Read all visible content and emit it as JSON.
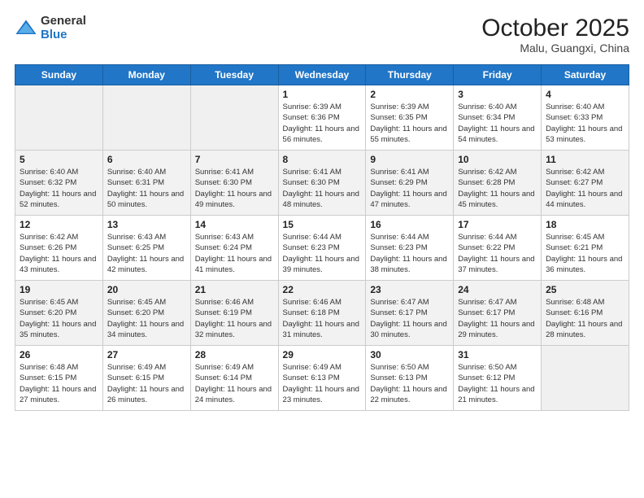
{
  "logo": {
    "line1": "General",
    "line2": "Blue"
  },
  "title": "October 2025",
  "subtitle": "Malu, Guangxi, China",
  "days_of_week": [
    "Sunday",
    "Monday",
    "Tuesday",
    "Wednesday",
    "Thursday",
    "Friday",
    "Saturday"
  ],
  "weeks": [
    [
      {
        "day": "",
        "info": ""
      },
      {
        "day": "",
        "info": ""
      },
      {
        "day": "",
        "info": ""
      },
      {
        "day": "1",
        "info": "Sunrise: 6:39 AM\nSunset: 6:36 PM\nDaylight: 11 hours and 56 minutes."
      },
      {
        "day": "2",
        "info": "Sunrise: 6:39 AM\nSunset: 6:35 PM\nDaylight: 11 hours and 55 minutes."
      },
      {
        "day": "3",
        "info": "Sunrise: 6:40 AM\nSunset: 6:34 PM\nDaylight: 11 hours and 54 minutes."
      },
      {
        "day": "4",
        "info": "Sunrise: 6:40 AM\nSunset: 6:33 PM\nDaylight: 11 hours and 53 minutes."
      }
    ],
    [
      {
        "day": "5",
        "info": "Sunrise: 6:40 AM\nSunset: 6:32 PM\nDaylight: 11 hours and 52 minutes."
      },
      {
        "day": "6",
        "info": "Sunrise: 6:40 AM\nSunset: 6:31 PM\nDaylight: 11 hours and 50 minutes."
      },
      {
        "day": "7",
        "info": "Sunrise: 6:41 AM\nSunset: 6:30 PM\nDaylight: 11 hours and 49 minutes."
      },
      {
        "day": "8",
        "info": "Sunrise: 6:41 AM\nSunset: 6:30 PM\nDaylight: 11 hours and 48 minutes."
      },
      {
        "day": "9",
        "info": "Sunrise: 6:41 AM\nSunset: 6:29 PM\nDaylight: 11 hours and 47 minutes."
      },
      {
        "day": "10",
        "info": "Sunrise: 6:42 AM\nSunset: 6:28 PM\nDaylight: 11 hours and 45 minutes."
      },
      {
        "day": "11",
        "info": "Sunrise: 6:42 AM\nSunset: 6:27 PM\nDaylight: 11 hours and 44 minutes."
      }
    ],
    [
      {
        "day": "12",
        "info": "Sunrise: 6:42 AM\nSunset: 6:26 PM\nDaylight: 11 hours and 43 minutes."
      },
      {
        "day": "13",
        "info": "Sunrise: 6:43 AM\nSunset: 6:25 PM\nDaylight: 11 hours and 42 minutes."
      },
      {
        "day": "14",
        "info": "Sunrise: 6:43 AM\nSunset: 6:24 PM\nDaylight: 11 hours and 41 minutes."
      },
      {
        "day": "15",
        "info": "Sunrise: 6:44 AM\nSunset: 6:23 PM\nDaylight: 11 hours and 39 minutes."
      },
      {
        "day": "16",
        "info": "Sunrise: 6:44 AM\nSunset: 6:23 PM\nDaylight: 11 hours and 38 minutes."
      },
      {
        "day": "17",
        "info": "Sunrise: 6:44 AM\nSunset: 6:22 PM\nDaylight: 11 hours and 37 minutes."
      },
      {
        "day": "18",
        "info": "Sunrise: 6:45 AM\nSunset: 6:21 PM\nDaylight: 11 hours and 36 minutes."
      }
    ],
    [
      {
        "day": "19",
        "info": "Sunrise: 6:45 AM\nSunset: 6:20 PM\nDaylight: 11 hours and 35 minutes."
      },
      {
        "day": "20",
        "info": "Sunrise: 6:45 AM\nSunset: 6:20 PM\nDaylight: 11 hours and 34 minutes."
      },
      {
        "day": "21",
        "info": "Sunrise: 6:46 AM\nSunset: 6:19 PM\nDaylight: 11 hours and 32 minutes."
      },
      {
        "day": "22",
        "info": "Sunrise: 6:46 AM\nSunset: 6:18 PM\nDaylight: 11 hours and 31 minutes."
      },
      {
        "day": "23",
        "info": "Sunrise: 6:47 AM\nSunset: 6:17 PM\nDaylight: 11 hours and 30 minutes."
      },
      {
        "day": "24",
        "info": "Sunrise: 6:47 AM\nSunset: 6:17 PM\nDaylight: 11 hours and 29 minutes."
      },
      {
        "day": "25",
        "info": "Sunrise: 6:48 AM\nSunset: 6:16 PM\nDaylight: 11 hours and 28 minutes."
      }
    ],
    [
      {
        "day": "26",
        "info": "Sunrise: 6:48 AM\nSunset: 6:15 PM\nDaylight: 11 hours and 27 minutes."
      },
      {
        "day": "27",
        "info": "Sunrise: 6:49 AM\nSunset: 6:15 PM\nDaylight: 11 hours and 26 minutes."
      },
      {
        "day": "28",
        "info": "Sunrise: 6:49 AM\nSunset: 6:14 PM\nDaylight: 11 hours and 24 minutes."
      },
      {
        "day": "29",
        "info": "Sunrise: 6:49 AM\nSunset: 6:13 PM\nDaylight: 11 hours and 23 minutes."
      },
      {
        "day": "30",
        "info": "Sunrise: 6:50 AM\nSunset: 6:13 PM\nDaylight: 11 hours and 22 minutes."
      },
      {
        "day": "31",
        "info": "Sunrise: 6:50 AM\nSunset: 6:12 PM\nDaylight: 11 hours and 21 minutes."
      },
      {
        "day": "",
        "info": ""
      }
    ]
  ]
}
